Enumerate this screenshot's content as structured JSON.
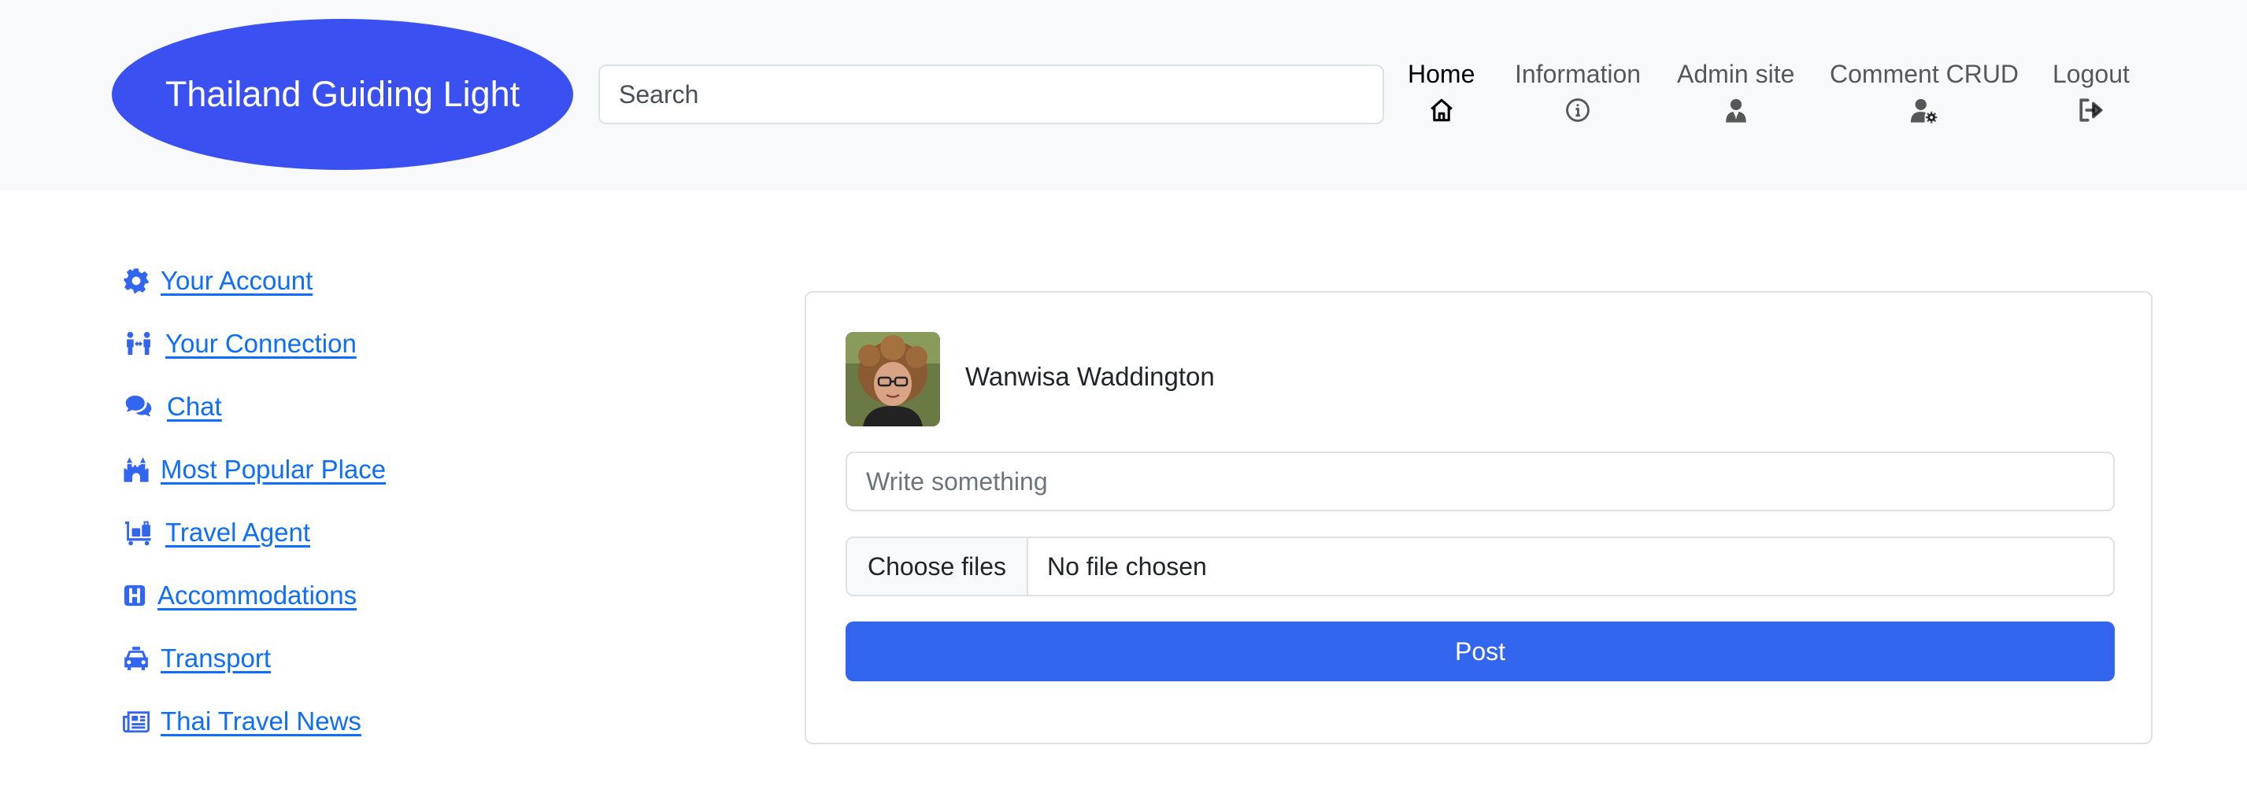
{
  "brand": "Thailand Guiding Light",
  "search": {
    "placeholder": "Search"
  },
  "nav": {
    "items": [
      {
        "label": "Home",
        "icon": "house-icon",
        "active": true
      },
      {
        "label": "Information",
        "icon": "info-circle-icon"
      },
      {
        "label": "Admin site",
        "icon": "user-tie-icon"
      },
      {
        "label": "Comment CRUD",
        "icon": "user-gear-icon"
      },
      {
        "label": "Logout",
        "icon": "sign-out-icon"
      }
    ]
  },
  "sidebar": {
    "items": [
      {
        "label": "Your Account",
        "icon": "gear-icon"
      },
      {
        "label": "Your Connection",
        "icon": "people-arrows-icon"
      },
      {
        "label": "Chat",
        "icon": "comments-icon"
      },
      {
        "label": "Most Popular Place",
        "icon": "castle-icon"
      },
      {
        "label": "Travel Agent",
        "icon": "luggage-cart-icon"
      },
      {
        "label": "Accommodations",
        "icon": "hotel-h-icon"
      },
      {
        "label": "Transport",
        "icon": "taxi-icon"
      },
      {
        "label": "Thai Travel News",
        "icon": "newspaper-icon"
      }
    ]
  },
  "post": {
    "username": "Wanwisa Waddington",
    "text_placeholder": "Write something",
    "file_button": "Choose files",
    "file_status": "No file chosen",
    "submit": "Post"
  },
  "colors": {
    "brand": "#3b50f0",
    "link": "#0d6efd",
    "button": "#3366ee",
    "navbar": "#f8f9fa"
  }
}
